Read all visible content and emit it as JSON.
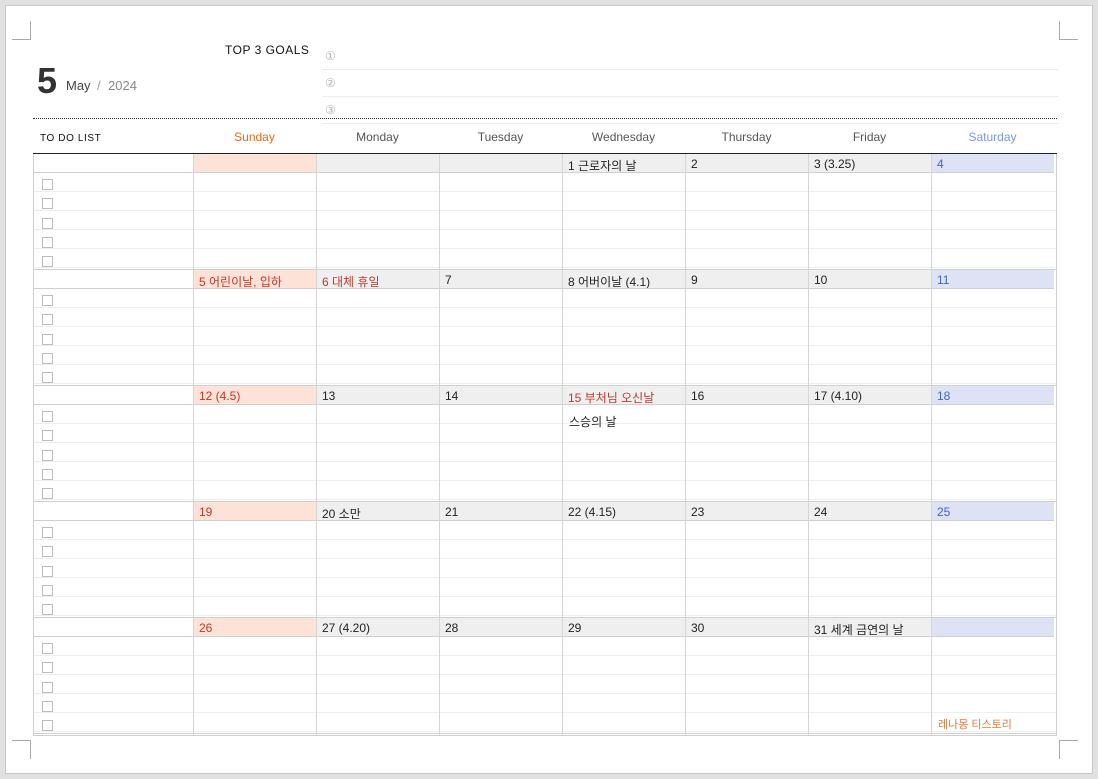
{
  "header": {
    "month_number": "5",
    "month_name": "May",
    "slash": "/",
    "year": "2024"
  },
  "goals": {
    "title": "TOP 3 GOALS",
    "numbers": [
      "①",
      "②",
      "③"
    ]
  },
  "todo_label": "TO DO LIST",
  "days": [
    "Sunday",
    "Monday",
    "Tuesday",
    "Wednesday",
    "Thursday",
    "Friday",
    "Saturday"
  ],
  "colors": {
    "sunday_header": "#e06a1b",
    "saturday_header": "#7a9ad8",
    "sunday_fill": "#fde2d8",
    "saturday_fill": "#dde3f5",
    "weekday_fill": "#efefef",
    "holiday_text": "#c0392b",
    "credit": "#e07b39"
  },
  "weeks": [
    {
      "cells": [
        "",
        "",
        "",
        "1 근로자의 날",
        "2",
        "3 (3.25)",
        "4"
      ],
      "holidays": []
    },
    {
      "cells": [
        "5 어린이날, 입하",
        "6 대체 휴일",
        "7",
        "8 어버이날 (4.1)",
        "9",
        "10",
        "11"
      ],
      "holidays": [
        1
      ]
    },
    {
      "cells": [
        "12 (4.5)",
        "13",
        "14",
        "15 부처님 오신날",
        "16",
        "17 (4.10)",
        "18"
      ],
      "holidays": [
        3
      ]
    },
    {
      "cells": [
        "19",
        "20 소만",
        "21",
        "22 (4.15)",
        "23",
        "24",
        "25"
      ],
      "holidays": []
    },
    {
      "cells": [
        "26",
        "27 (4.20)",
        "28",
        "29",
        "30",
        "31 세계 금연의 날",
        ""
      ],
      "holidays": []
    }
  ],
  "notes": [
    "스승의 날"
  ],
  "credit": "레나몽 티스토리"
}
